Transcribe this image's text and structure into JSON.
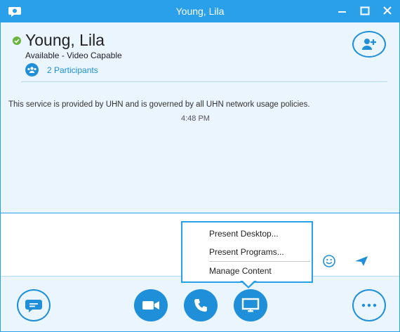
{
  "window": {
    "title": "Young, Lila",
    "app_icon": "skype-chat-icon",
    "controls": [
      "minimize-icon",
      "maximize-icon",
      "close-icon"
    ]
  },
  "contact": {
    "name": "Young, Lila",
    "status": "Available - Video Capable",
    "presence": "available",
    "participants_label": "2 Participants"
  },
  "conversation": {
    "service_message": "This service is provided by UHN and is governed by all UHN network usage policies.",
    "time": "4:48 PM"
  },
  "present_menu": {
    "items": [
      {
        "label": "Present Desktop..."
      },
      {
        "label": "Present Programs..."
      },
      {
        "label": "Manage Content"
      }
    ]
  },
  "bottom_bar": {
    "buttons": [
      "chat-icon",
      "video-camera-icon",
      "phone-icon",
      "monitor-icon",
      "more-icon"
    ]
  },
  "colors": {
    "accent": "#2aa0ea",
    "button_blue": "#1e8fd8",
    "presence_green": "#6cb33f",
    "background": "#eaf5fd"
  }
}
